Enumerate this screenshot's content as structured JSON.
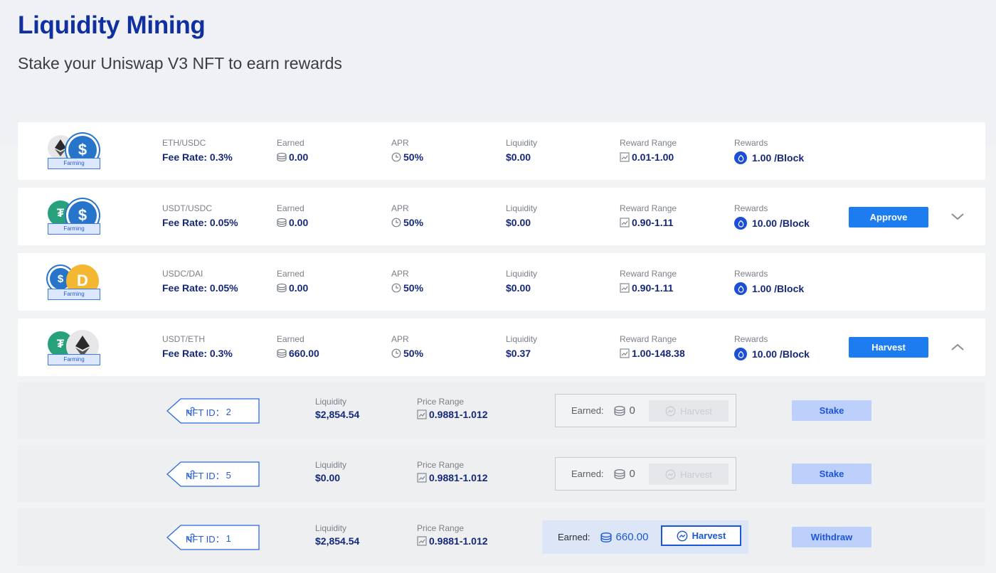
{
  "header": {
    "title": "Liquidity Mining",
    "subtitle": "Stake your Uniswap V3 NFT to earn rewards"
  },
  "labels": {
    "earned": "Earned",
    "apr": "APR",
    "liquidity": "Liquidity",
    "reward_range": "Reward Range",
    "rewards": "Rewards",
    "farming_tag": "Farming",
    "price_range": "Price Range",
    "earned_colon": "Earned:",
    "nft_prefix": "NFT ID："
  },
  "colors": {
    "brand": "#1030a0",
    "primary_button": "#1c7cf0",
    "stake_button": "#bcd0fb",
    "usdc": "#2775ca",
    "usdt": "#26a17b",
    "dai": "#f4b731"
  },
  "pools": [
    {
      "pair": "ETH/USDC",
      "fee": "Fee Rate: 0.3%",
      "earned": "0.00",
      "apr": "50%",
      "liquidity": "$0.00",
      "reward_range": "0.01-1.00",
      "rewards": "1.00 /Block",
      "tokens": [
        "eth-icon",
        "usdc-icon"
      ]
    },
    {
      "pair": "USDT/USDC",
      "fee": "Fee Rate: 0.05%",
      "earned": "0.00",
      "apr": "50%",
      "liquidity": "$0.00",
      "reward_range": "0.90-1.11",
      "rewards": "10.00 /Block",
      "tokens": [
        "usdt-icon",
        "usdc-icon"
      ],
      "action": "Approve",
      "chevron": "chevron-down-icon"
    },
    {
      "pair": "USDC/DAI",
      "fee": "Fee Rate: 0.05%",
      "earned": "0.00",
      "apr": "50%",
      "liquidity": "$0.00",
      "reward_range": "0.90-1.11",
      "rewards": "1.00 /Block",
      "tokens": [
        "usdc-icon",
        "dai-icon"
      ]
    },
    {
      "pair": "USDT/ETH",
      "fee": "Fee Rate: 0.3%",
      "earned": "660.00",
      "apr": "50%",
      "liquidity": "$0.37",
      "reward_range": "1.00-148.38",
      "rewards": "10.00 /Block",
      "tokens": [
        "usdt-icon",
        "eth-icon"
      ],
      "action": "Harvest",
      "chevron": "chevron-up-icon"
    }
  ],
  "nfts": [
    {
      "id": "2",
      "liquidity": "$2,854.54",
      "price_range": "0.9881-1.012",
      "earned": "0",
      "harvest_label": "Harvest",
      "harvest_enabled": false,
      "action": "Stake"
    },
    {
      "id": "5",
      "liquidity": "$0.00",
      "price_range": "0.9881-1.012",
      "earned": "0",
      "harvest_label": "Harvest",
      "harvest_enabled": false,
      "action": "Stake"
    },
    {
      "id": "1",
      "liquidity": "$2,854.54",
      "price_range": "0.9881-1.012",
      "earned": "660.00",
      "harvest_label": "Harvest",
      "harvest_enabled": true,
      "action": "Withdraw"
    }
  ]
}
